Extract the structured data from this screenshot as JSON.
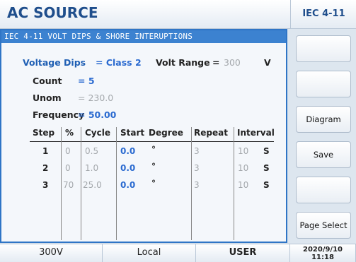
{
  "header": {
    "title": "AC SOURCE",
    "code": "IEC 4-11"
  },
  "panel": {
    "title": "IEC 4-11 VOLT DIPS & SHORE INTERUPTIONS",
    "voltage_dips_label": "Voltage Dips",
    "voltage_dips_value": "= Class 2",
    "volt_range_label": "Volt Range",
    "volt_range_eq": "=",
    "volt_range_value": "300",
    "volt_range_unit": "V",
    "count_label": "Count",
    "count_value": "= 5",
    "unom_label": "Unom",
    "unom_value": "= 230.0",
    "frequency_label": "Frequency",
    "frequency_value": "= 50.00"
  },
  "table": {
    "headers": [
      "Step",
      "%",
      "Cycle",
      "Start",
      "Degree",
      "Repeat",
      "Interval"
    ],
    "rows": [
      {
        "step": "1",
        "pct": "0",
        "cycle": "0.5",
        "start": "0.0",
        "degree": "°",
        "repeat": "3",
        "interval": "10",
        "unit": "S"
      },
      {
        "step": "2",
        "pct": "0",
        "cycle": "1.0",
        "start": "0.0",
        "degree": "°",
        "repeat": "3",
        "interval": "10",
        "unit": "S"
      },
      {
        "step": "3",
        "pct": "70",
        "cycle": "25.0",
        "start": "0.0",
        "degree": "°",
        "repeat": "3",
        "interval": "10",
        "unit": "S"
      }
    ]
  },
  "sidebar": {
    "buttons": [
      "",
      "",
      "Diagram",
      "Save",
      "",
      "Page Select"
    ]
  },
  "status": {
    "range": "300V",
    "mode": "Local",
    "user": "USER",
    "date": "2020/9/10",
    "time": "11:18"
  }
}
